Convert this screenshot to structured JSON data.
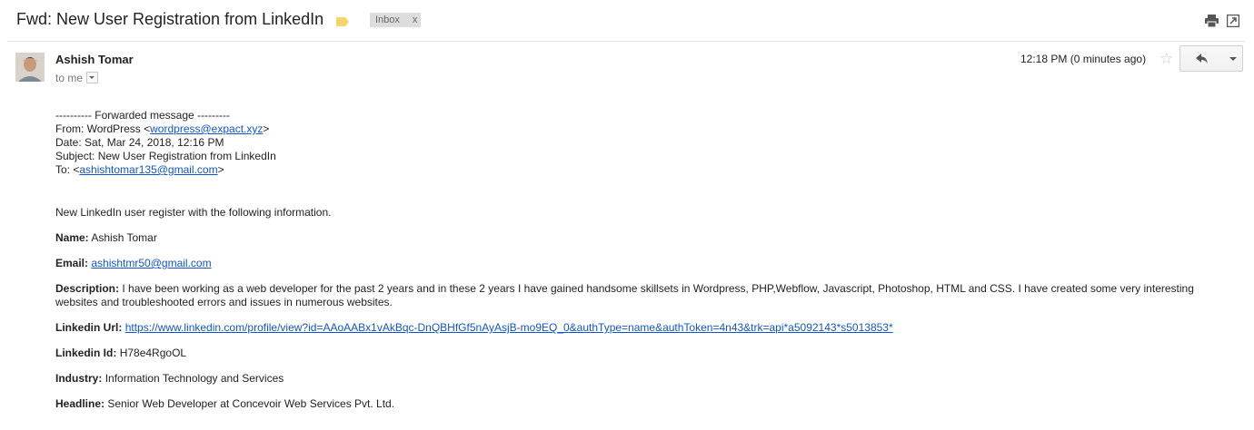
{
  "email": {
    "subject": "Fwd: New User Registration from LinkedIn",
    "label_chip": "Inbox",
    "label_chip_remove": "x",
    "sender_name": "Ashish Tomar",
    "recipient_line": "to me",
    "timestamp": "12:18 PM (0 minutes ago)"
  },
  "forwarded": {
    "header": "---------- Forwarded message ---------",
    "from_label": "From: WordPress <",
    "from_email": "wordpress@expact.xyz",
    "from_suffix": ">",
    "date": "Date: Sat, Mar 24, 2018, 12:16 PM",
    "subject": "Subject: New User Registration from LinkedIn",
    "to_label": "To: <",
    "to_email": "ashishtomar135@gmail.com",
    "to_suffix": ">"
  },
  "message": {
    "intro": "New LinkedIn user register with the following information.",
    "fields": {
      "name_label": "Name:",
      "name_value": "Ashish Tomar",
      "email_label": "Email:",
      "email_value": "ashishtmr50@gmail.com",
      "description_label": "Description:",
      "description_value": "I have been working as a web developer for the past 2 years and in these 2 years I have gained handsome skillsets in Wordpress, PHP,Webflow, Javascript, Photoshop, HTML and CSS. I have created some very interesting websites and troubleshooted errors and issues in numerous websites.",
      "linkedin_url_label": "Linkedin Url:",
      "linkedin_url_value": "https://www.linkedin.com/profile/view?id=AAoAABx1vAkBqc-DnQBHfGf5nAyAsjB-mo9EQ_0&authType=name&authToken=4n43&trk=api*a5092143*s5013853*",
      "linkedin_id_label": "Linkedin Id:",
      "linkedin_id_value": "H78e4RgoOL",
      "industry_label": "Industry:",
      "industry_value": "Information Technology and Services",
      "headline_label": "Headline:",
      "headline_value": "Senior Web Developer at Concevoir Web Services Pvt. Ltd."
    }
  },
  "icons": {
    "label_tag": "label-tag-icon",
    "print": "print-icon",
    "new_window": "new-window-icon",
    "star": "star-icon",
    "reply": "reply-icon",
    "more": "chevron-down-icon"
  },
  "colors": {
    "link": "#1155cc",
    "label_tag": "#f4d46b",
    "chip_bg": "#dddddd"
  }
}
